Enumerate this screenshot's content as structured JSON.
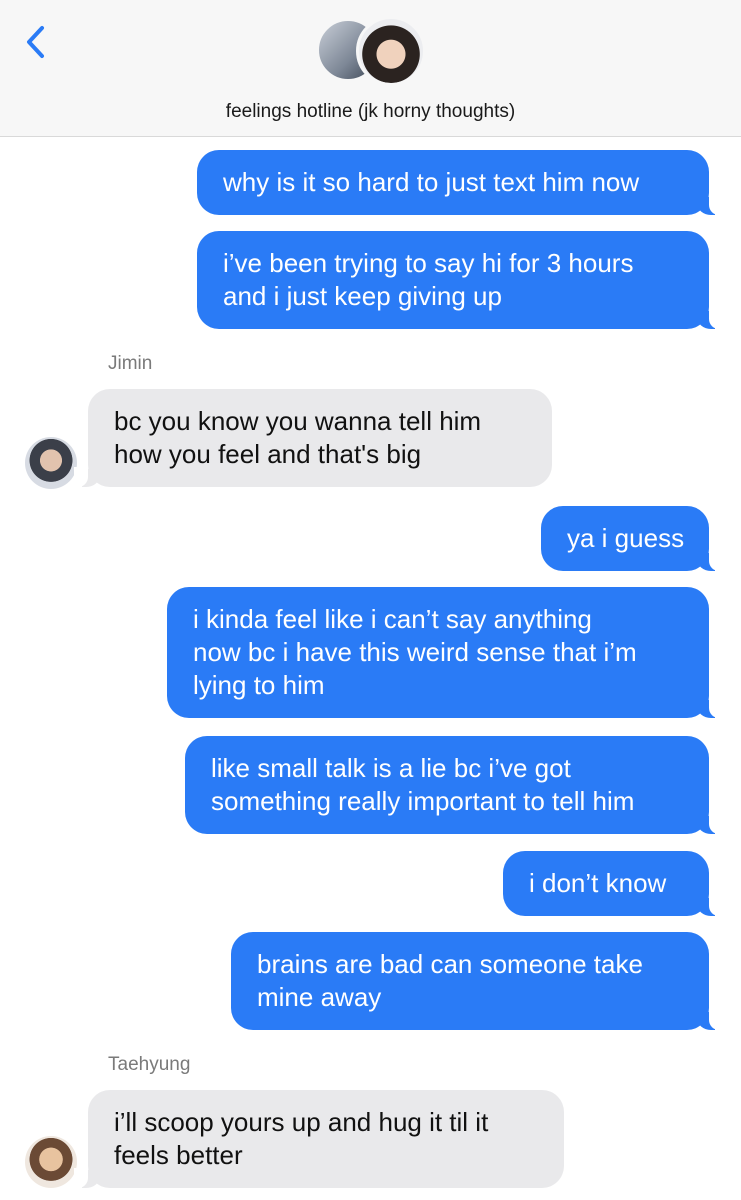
{
  "header": {
    "title": "feelings hotline (jk horny thoughts)",
    "back_icon": "chevron-left-icon",
    "accent": "#2a7bf6"
  },
  "messages": [
    {
      "direction": "outgoing",
      "lines": [
        "why is it so hard to just text him now"
      ]
    },
    {
      "direction": "outgoing",
      "lines": [
        "i’ve been trying to say hi for 3 hours",
        "and i just keep giving up"
      ]
    },
    {
      "direction": "incoming",
      "sender": "Jimin",
      "lines": [
        "bc you know you wanna tell him",
        "how you feel and that's big"
      ]
    },
    {
      "direction": "outgoing",
      "lines": [
        "ya i guess"
      ]
    },
    {
      "direction": "outgoing",
      "lines": [
        "i kinda feel like i can’t say anything",
        "now bc i have this weird sense that i’m",
        "lying to him"
      ]
    },
    {
      "direction": "outgoing",
      "lines": [
        "like small talk is a lie bc i’ve got",
        "something really important to tell him"
      ]
    },
    {
      "direction": "outgoing",
      "lines": [
        "i don’t know"
      ]
    },
    {
      "direction": "outgoing",
      "lines": [
        "brains are bad can someone take",
        "mine away"
      ]
    },
    {
      "direction": "incoming",
      "sender": "Taehyung",
      "lines": [
        "i’ll scoop yours up and hug it til it",
        "feels better"
      ]
    }
  ],
  "colors": {
    "outgoing_bubble": "#2a7bf6",
    "incoming_bubble": "#e9e9eb",
    "header_bg": "#f7f7f7"
  }
}
